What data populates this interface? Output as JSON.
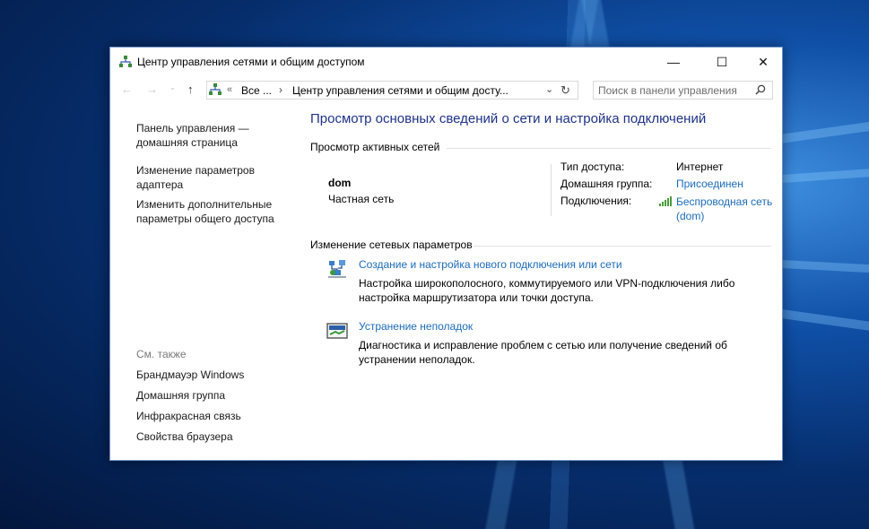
{
  "window": {
    "title": "Центр управления сетями и общим доступом",
    "minimize": "—",
    "maximize": "☐",
    "close": "✕"
  },
  "address": {
    "back": "←",
    "forward": "→",
    "up": "↑",
    "overflow": "«",
    "crumb_root": "Все ...",
    "separator": "›",
    "crumb_current": "Центр управления сетями и общим досту...",
    "dropdown": "⌄",
    "refresh": "↻"
  },
  "search": {
    "placeholder": "Поиск в панели управления",
    "icon": "search-icon"
  },
  "sidebar": {
    "home": [
      "Панель управления —",
      "домашняя страница"
    ],
    "adapter": [
      "Изменение параметров",
      "адаптера"
    ],
    "sharing": [
      "Изменить дополнительные",
      "параметры общего доступа"
    ],
    "see_also": "См. также",
    "links": [
      "Брандмауэр Windows",
      "Домашняя группа",
      "Инфракрасная связь",
      "Свойства браузера"
    ]
  },
  "main": {
    "heading": "Просмотр основных сведений о сети и настройка подключений",
    "active_title": "Просмотр активных сетей",
    "network": {
      "name": "dom",
      "type": "Частная сеть",
      "access_label": "Тип доступа:",
      "access_value": "Интернет",
      "homegroup_label": "Домашняя группа:",
      "homegroup_value": "Присоединен",
      "connections_label": "Подключения:",
      "connection_value_1": "Беспроводная сеть",
      "connection_value_2": "(dom)"
    },
    "change_title": "Изменение сетевых параметров",
    "tasks": [
      {
        "title": "Создание и настройка нового подключения или сети",
        "desc": [
          "Настройка широкополосного, коммутируемого или VPN-подключения либо",
          "настройка маршрутизатора или точки доступа."
        ]
      },
      {
        "title": "Устранение неполадок",
        "desc": [
          "Диагностика и исправление проблем с сетью или получение сведений об",
          "устранении неполадок."
        ]
      }
    ]
  },
  "colors": {
    "heading": "#1e3287",
    "link": "#1c6bb8",
    "desktop": "#0f4fa6"
  }
}
